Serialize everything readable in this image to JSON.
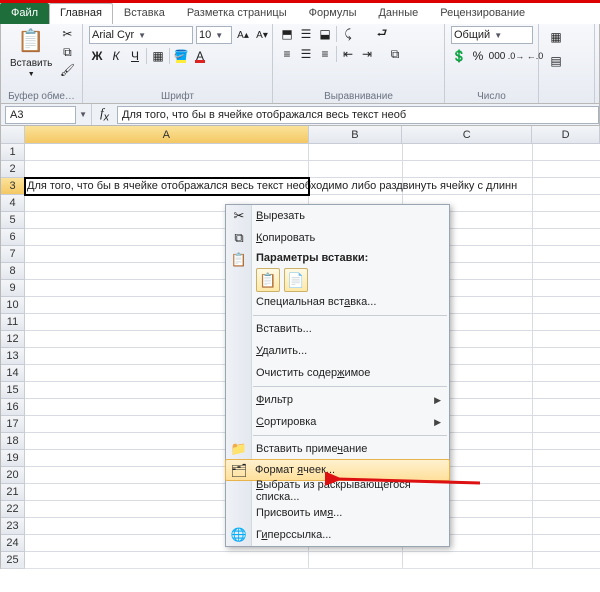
{
  "tabs": {
    "file": "Файл",
    "home": "Главная",
    "insert": "Вставка",
    "pagelayout": "Разметка страницы",
    "formulas": "Формулы",
    "data": "Данные",
    "review": "Рецензирование"
  },
  "ribbon": {
    "clipboard": {
      "paste": "Вставить",
      "title": "Буфер обме…"
    },
    "font": {
      "name": "Arial Cyr",
      "size": "10",
      "title": "Шрифт",
      "bold": "Ж",
      "italic": "К",
      "underline": "Ч"
    },
    "alignment": {
      "title": "Выравнивание"
    },
    "number": {
      "format": "Общий",
      "title": "Число"
    }
  },
  "namebox": "A3",
  "formula": "Для того, что бы в ячейке отображался весь текст необ",
  "columns": [
    "A",
    "B",
    "C",
    "D"
  ],
  "rows": [
    "1",
    "2",
    "3",
    "4",
    "5",
    "6",
    "7",
    "8",
    "9",
    "10",
    "11",
    "12",
    "13",
    "14",
    "15",
    "16",
    "17",
    "18",
    "19",
    "20",
    "21",
    "22",
    "23",
    "24",
    "25"
  ],
  "cellA3": "Для того, что бы в ячейке отображался весь текст необходимо либо раздвинуть ячейку с длинн",
  "ctx": {
    "cut": "Вырезать",
    "copy": "Копировать",
    "paste_opts": "Параметры вставки:",
    "paste_special": "Специальная вставка...",
    "insert": "Вставить...",
    "delete": "Удалить...",
    "clear": "Очистить содержимое",
    "filter": "Фильтр",
    "sort": "Сортировка",
    "comment": "Вставить примечание",
    "format": "Формат ячеек...",
    "dropdown": "Выбрать из раскрывающегося списка...",
    "defname": "Присвоить имя...",
    "hyperlink": "Гиперссылка..."
  }
}
